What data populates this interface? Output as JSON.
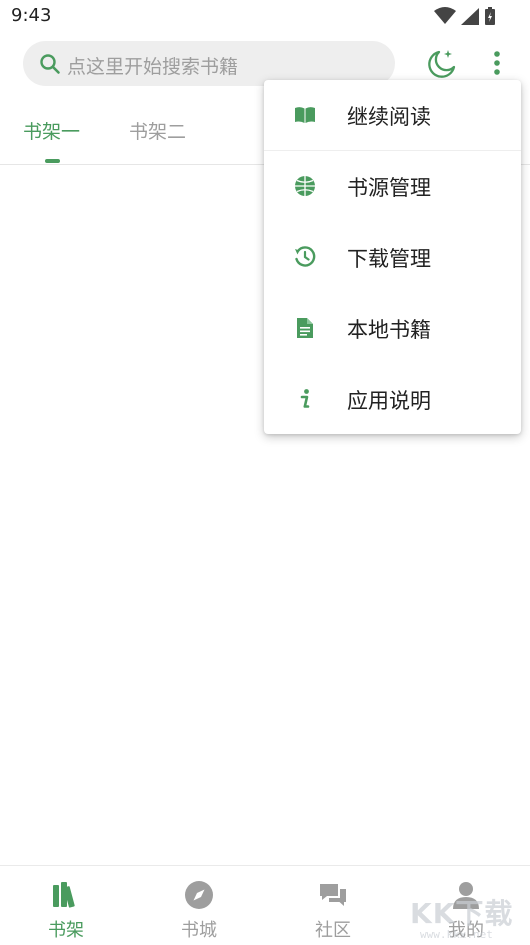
{
  "status_bar": {
    "time": "9:43"
  },
  "search": {
    "placeholder": "点这里开始搜索书籍"
  },
  "tabs": [
    {
      "label": "书架一",
      "active": true
    },
    {
      "label": "书架二",
      "active": false
    }
  ],
  "menu": {
    "items": [
      {
        "label": "继续阅读",
        "icon": "book-open-icon"
      },
      {
        "label": "书源管理",
        "icon": "globe-icon"
      },
      {
        "label": "下载管理",
        "icon": "history-icon"
      },
      {
        "label": "本地书籍",
        "icon": "document-icon"
      },
      {
        "label": "应用说明",
        "icon": "info-icon"
      }
    ]
  },
  "bottom_nav": {
    "items": [
      {
        "label": "书架",
        "icon": "bookshelf-icon",
        "active": true
      },
      {
        "label": "书城",
        "icon": "compass-icon",
        "active": false
      },
      {
        "label": "社区",
        "icon": "chat-icon",
        "active": false
      },
      {
        "label": "我的",
        "icon": "person-icon",
        "active": false
      }
    ]
  },
  "watermark": {
    "text": "KK下载",
    "url": "www.kkx.net"
  },
  "colors": {
    "accent": "#4a9b5e",
    "muted": "#9e9e9e",
    "search_bg": "#eeeeee"
  }
}
